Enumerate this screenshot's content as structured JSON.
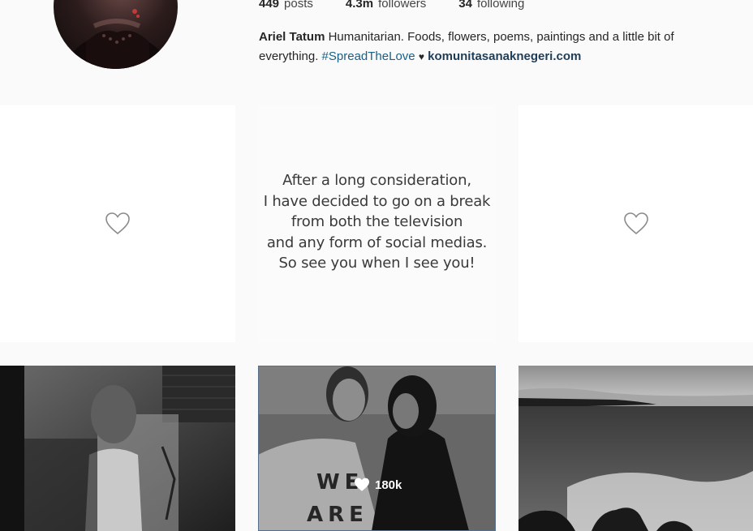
{
  "profile": {
    "stats": [
      {
        "num": "449",
        "label": "posts"
      },
      {
        "num": "4.3m",
        "label": "followers"
      },
      {
        "num": "34",
        "label": "following"
      }
    ],
    "name": "Ariel Tatum",
    "bio_text": "Humanitarian. Foods, flowers, poems, paintings and a little bit of everything.",
    "hashtag": "#SpreadTheLove",
    "heart": "♥",
    "website": "komunitasanaknegeri.com"
  },
  "posts": {
    "quote_lines": [
      "After a long consideration,",
      "I have decided to go on a break",
      "from both the television",
      "and any form of social medias.",
      "So see you when I see you!"
    ],
    "shirt_text_1": "WE",
    "shirt_text_2": "ARE",
    "hover_likes": "180k"
  }
}
